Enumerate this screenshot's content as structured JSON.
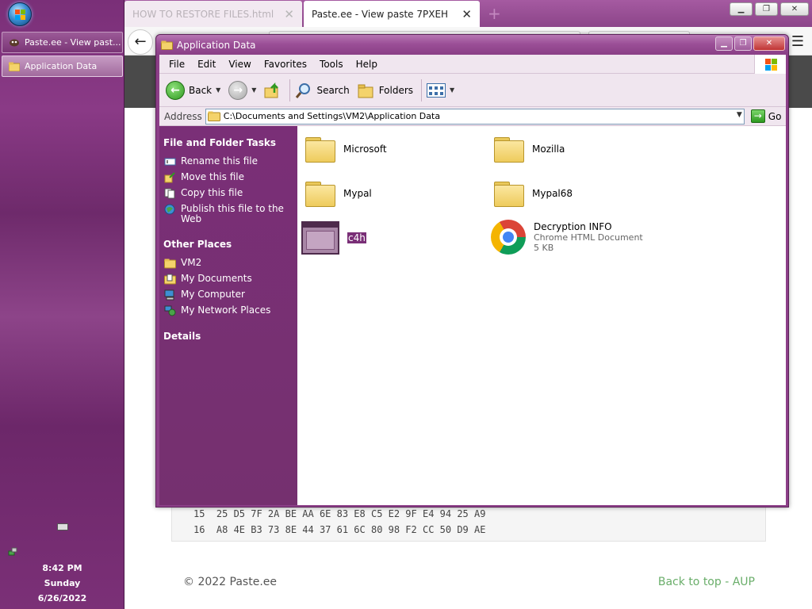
{
  "taskbar": {
    "items": [
      {
        "label": "Paste.ee - View past...",
        "active": false
      },
      {
        "label": "Application Data",
        "active": true
      }
    ],
    "clock": {
      "time": "8:42 PM",
      "day": "Sunday",
      "date": "6/26/2022"
    }
  },
  "browser": {
    "tabs": [
      {
        "label": "HOW TO RESTORE FILES.html"
      },
      {
        "label": "Paste.ee - View paste 7PXEH"
      }
    ],
    "hex_lines": [
      "15  25 D5 7F 2A BE AA 6E 83 E8 C5 E2 9F E4 94 25 A9",
      "16  A8 4E B3 73 8E 44 37 61 6C 80 98 F2 CC 50 D9 AE"
    ],
    "footer": {
      "copyright": "© 2022 Paste.ee",
      "back_to_top": "Back to top",
      "separator": " - ",
      "aup": "AUP"
    }
  },
  "explorer": {
    "title": "Application Data",
    "menu": [
      "File",
      "Edit",
      "View",
      "Favorites",
      "Tools",
      "Help"
    ],
    "toolbar": {
      "back_label": "Back",
      "search_label": "Search",
      "folders_label": "Folders"
    },
    "address": {
      "label": "Address",
      "path": "C:\\Documents and Settings\\VM2\\Application Data",
      "go_label": "Go"
    },
    "tasks": {
      "file_folder_heading": "File and Folder Tasks",
      "file_folder_items": [
        "Rename this file",
        "Move this file",
        "Copy this file",
        "Publish this file to the Web"
      ],
      "other_places_heading": "Other Places",
      "other_places_items": [
        "VM2",
        "My Documents",
        "My Computer",
        "My Network Places"
      ],
      "details_heading": "Details"
    },
    "files": [
      {
        "name": "Microsoft",
        "type": "folder"
      },
      {
        "name": "Mozilla",
        "type": "folder"
      },
      {
        "name": "Mypal",
        "type": "folder"
      },
      {
        "name": "Mypal68",
        "type": "folder"
      },
      {
        "name": "c4h",
        "type": "application",
        "selected": true
      },
      {
        "name": "Decryption INFO",
        "type": "chrome-html",
        "subtitle": "Chrome HTML Document",
        "size": "5 KB"
      }
    ]
  },
  "colors": {
    "theme_purple": "#8c3f88",
    "taskpane_purple": "#7a2f77",
    "footer_link_green": "#6aae6a"
  }
}
